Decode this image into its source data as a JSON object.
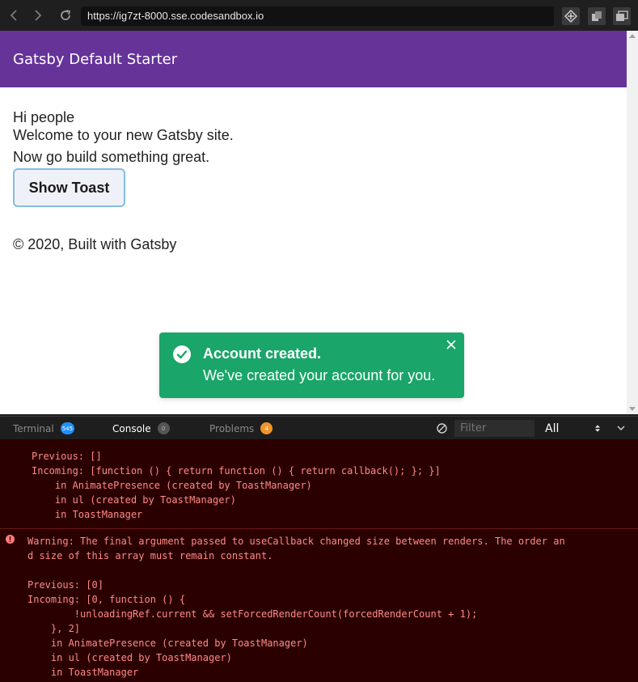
{
  "browser": {
    "url": "https://ig7zt-8000.sse.codesandbox.io"
  },
  "site": {
    "title": "Gatsby Default Starter",
    "heading": "Hi people",
    "welcome": "Welcome to your new Gatsby site.",
    "tagline": "Now go build something great.",
    "button_label": "Show Toast",
    "footer": "© 2020, Built with Gatsby"
  },
  "toast": {
    "title": "Account created.",
    "message": "We've created your account for you.",
    "color": "#1aa56a"
  },
  "devtools": {
    "tabs": [
      {
        "label": "Terminal",
        "count": "545",
        "badge_color": "#1e90ff"
      },
      {
        "label": "Console",
        "count": "0",
        "badge_color": "#555555"
      },
      {
        "label": "Problems",
        "count": "4",
        "badge_color": "#f0952c"
      }
    ],
    "filter_placeholder": "Filter",
    "level": "All",
    "console_lines": [
      "Previous: []",
      "Incoming: [function () { return function () { return callback(); }; }]",
      "    in AnimatePresence (created by ToastManager)",
      "    in ul (created by ToastManager)",
      "    in ToastManager",
      "Warning: The final argument passed to useCallback changed size between renders. The order an",
      "d size of this array must remain constant.",
      "Previous: [0]",
      "Incoming: [0, function () {",
      "        !unloadingRef.current && setForcedRenderCount(forcedRenderCount + 1);",
      "    }, 2]",
      "    in AnimatePresence (created by ToastManager)",
      "    in ul (created by ToastManager)",
      "    in ToastManager"
    ]
  }
}
